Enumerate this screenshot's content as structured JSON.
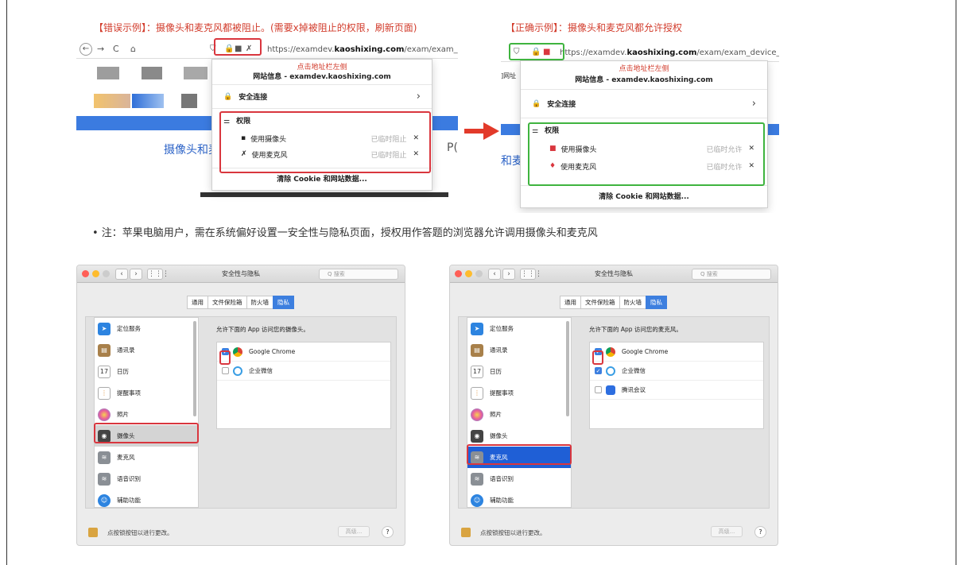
{
  "wrong": {
    "caption": "【错误示例】：摄像头和麦克风都被阻止。(需要x掉被阻止的权限，刷新页面)",
    "url_pre": "https://examdev.",
    "url_host": "kaoshixing.com",
    "url_post": "/exam/exam_device_deb",
    "hint": "点击地址栏左侧",
    "popup_title": "网站信息 - examdev.kaoshixing.com",
    "secure": "安全连接",
    "perm_title": "权限",
    "rows": [
      {
        "label": "使用摄像头",
        "status": "已临时阻止",
        "x": "✕"
      },
      {
        "label": "使用麦克风",
        "status": "已临时阻止",
        "x": "✕"
      }
    ],
    "footer": "清除 Cookie 和网站数据...",
    "page_text": "摄像头和麦",
    "page_text2": "P("
  },
  "right": {
    "caption": "【正确示例】：摄像头和麦克风都允许授权",
    "url_pre": "https://examdev.",
    "url_host": "kaoshixing.com",
    "url_post": "/exam/exam_device_de",
    "hint": "点击地址栏左侧",
    "side_label": "]网址",
    "popup_title": "网站信息 - examdev.kaoshixing.com",
    "secure": "安全连接",
    "perm_title": "权限",
    "rows": [
      {
        "label": "使用摄像头",
        "status": "已临时允许",
        "x": "✕"
      },
      {
        "label": "使用麦克风",
        "status": "已临时允许",
        "x": "✕"
      }
    ],
    "footer": "清除 Cookie 和网站数据...",
    "page_text": "和麦"
  },
  "arrow_color": "#e23a2a",
  "note": "• 注：苹果电脑用户，需在系统偏好设置一安全性与隐私页面，授权用作答题的浏览器允许调用摄像头和麦克风",
  "mac": {
    "title": "安全性与隐私",
    "search": "Q 搜索",
    "tabs": [
      "通用",
      "文件保险箱",
      "防火墙",
      "隐私"
    ],
    "sidebar": [
      "定位服务",
      "通讯录",
      "日历",
      "提醒事项",
      "照片",
      "摄像头",
      "麦克风",
      "语音识别",
      "辅助功能"
    ],
    "calendar_day": "17",
    "lock_text": "点按锁按钮以进行更改。",
    "advanced": "高级...",
    "help": "?"
  },
  "mac_left": {
    "label": "允许下面的 App 访问您的摄像头。",
    "apps": [
      {
        "name": "Google Chrome",
        "checked": true
      },
      {
        "name": "企业微信",
        "checked": false
      }
    ]
  },
  "mac_right": {
    "label": "允许下面的 App 访问您的麦克风。",
    "apps": [
      {
        "name": "Google Chrome",
        "checked": true
      },
      {
        "name": "企业微信",
        "checked": true
      },
      {
        "name": "腾讯会议",
        "checked": false
      }
    ]
  }
}
